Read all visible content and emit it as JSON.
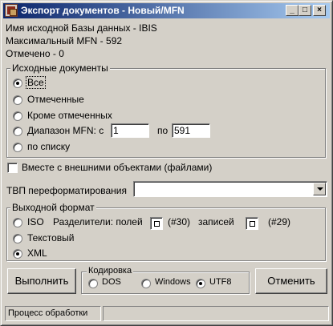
{
  "window": {
    "title": "Экспорт документов - Новый/MFN"
  },
  "title_buttons": {
    "minimize": "_",
    "maximize": "□",
    "close": "×"
  },
  "info": {
    "db_name": "Имя исходной Базы данных - IBIS",
    "max_mfn": "Максимальный MFN  - 592",
    "marked": "Отмечено - 0"
  },
  "source_docs": {
    "title": "Исходные документы",
    "options": {
      "all": "Все",
      "marked": "Отмеченные",
      "except_marked": "Кроме отмеченных",
      "range": "Диапазон MFN:  с",
      "by_list": "по списку"
    },
    "selected": "all",
    "range_to_label": "по",
    "range_from": "1",
    "range_to": "591"
  },
  "with_external": "Вместе с внешними объектами (файлами)",
  "tvp": {
    "label": "ТВП переформатирования",
    "value": ""
  },
  "output_format": {
    "title": "Выходной формат",
    "iso": "ISO",
    "delimiters_label": "Разделители: полей",
    "field_code": "(#30)",
    "records_label": "записей",
    "record_code": "(#29)",
    "text": "Текстовый",
    "xml": "XML",
    "selected": "xml"
  },
  "encoding": {
    "title": "Кодировка",
    "dos": "DOS",
    "windows": "Windows",
    "utf8": "UTF8",
    "selected": "utf8"
  },
  "buttons": {
    "execute": "Выполнить",
    "cancel": "Отменить"
  },
  "status": {
    "text": "Процесс обработки"
  },
  "colors": {
    "title_start": "#0a246a",
    "title_end": "#a6caf0",
    "face": "#d4d0c8"
  }
}
